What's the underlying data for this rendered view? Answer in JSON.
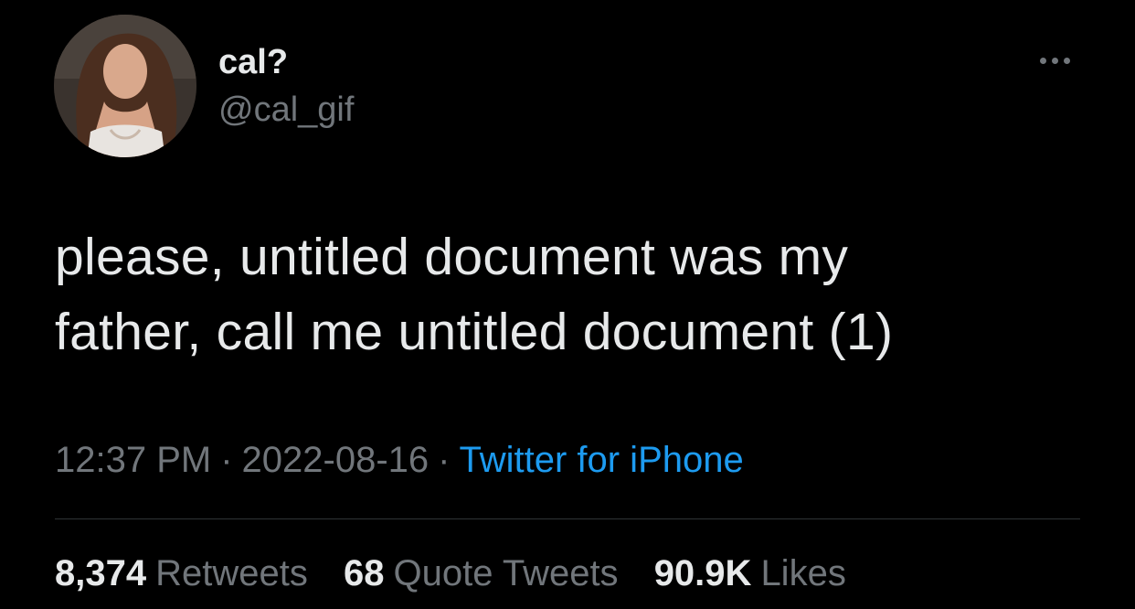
{
  "user": {
    "display_name": "cal?",
    "handle": "@cal_gif"
  },
  "tweet": {
    "text_line1": "please, untitled document was my",
    "text_line2": "father, call me untitled document (1)"
  },
  "meta": {
    "time": "12:37 PM",
    "separator": "·",
    "date": "2022-08-16",
    "source": "Twitter for iPhone"
  },
  "stats": {
    "retweets_count": "8,374",
    "retweets_label": "Retweets",
    "quotes_count": "68",
    "quotes_label": "Quote Tweets",
    "likes_count": "90.9K",
    "likes_label": "Likes"
  },
  "colors": {
    "background": "#000000",
    "primary_text": "#e7e9ea",
    "secondary_text": "#71767b",
    "link": "#1d9bf0",
    "divider": "#2f3336"
  }
}
